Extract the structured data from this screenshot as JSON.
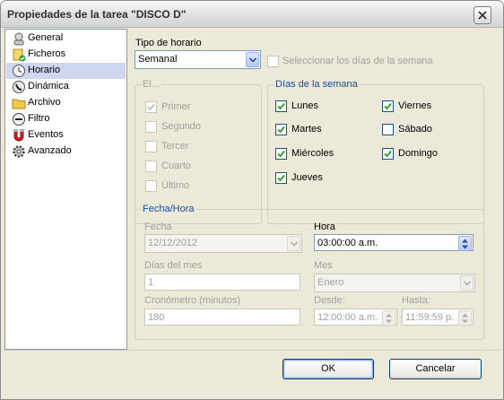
{
  "window": {
    "title": "Propiedades de la tarea \"DISCO D\""
  },
  "nav": {
    "items": [
      {
        "label": "General",
        "icon": "user-icon"
      },
      {
        "label": "Ficheros",
        "icon": "folder-check-icon"
      },
      {
        "label": "Horario",
        "icon": "clock-icon",
        "selected": true
      },
      {
        "label": "Dinámica",
        "icon": "phone-icon"
      },
      {
        "label": "Archivo",
        "icon": "folder-icon"
      },
      {
        "label": "Filtro",
        "icon": "filter-icon"
      },
      {
        "label": "Eventos",
        "icon": "magnet-icon"
      },
      {
        "label": "Avanzado",
        "icon": "gear-icon"
      }
    ]
  },
  "schedule": {
    "type_label": "Tipo de horario",
    "type_value": "Semanal",
    "select_days_label": "Seleccionar los días de la semana"
  },
  "el_group": {
    "title": "El...",
    "items": [
      {
        "label": "Primer",
        "checked": true
      },
      {
        "label": "Segundo",
        "checked": false
      },
      {
        "label": "Tercer",
        "checked": false
      },
      {
        "label": "Cuarto",
        "checked": false
      },
      {
        "label": "Último",
        "checked": false
      }
    ]
  },
  "days_group": {
    "title": "Días de la semana",
    "days": [
      {
        "label": "Lunes",
        "checked": true
      },
      {
        "label": "Martes",
        "checked": true
      },
      {
        "label": "Miércoles",
        "checked": true
      },
      {
        "label": "Jueves",
        "checked": true
      },
      {
        "label": "Viernes",
        "checked": true
      },
      {
        "label": "Sábado",
        "checked": false
      },
      {
        "label": "Domingo",
        "checked": true
      }
    ]
  },
  "datetime_group": {
    "title": "Fecha/Hora",
    "fecha_label": "Fecha",
    "fecha_value": "12/12/2012",
    "hora_label": "Hora",
    "hora_value": "03:00:00 a.m.",
    "dias_label": "Días del mes",
    "dias_value": "1",
    "mes_label": "Mes",
    "mes_value": "Enero",
    "crono_label": "Cronómetro (minutos)",
    "crono_value": "180",
    "desde_label": "Desde:",
    "desde_value": "12:00:00 a.m.",
    "hasta_label": "Hasta:",
    "hasta_value": "11:59:59 p."
  },
  "buttons": {
    "ok": "OK",
    "cancel": "Cancelar"
  },
  "colors": {
    "accent": "#1c5180",
    "selected_bg": "#cfd6ef",
    "window_bg": "#ece9d8"
  }
}
